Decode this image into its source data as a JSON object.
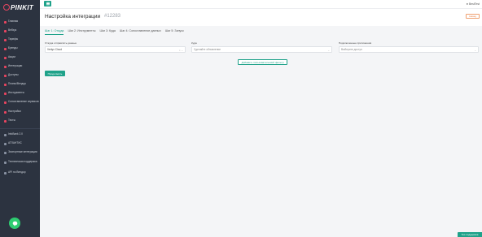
{
  "app": {
    "logo": "PINKIT"
  },
  "topbar": {
    "user_name": "BestTest"
  },
  "header": {
    "title": "Настройка интеграции",
    "id": "#12283",
    "back_label": "Назад"
  },
  "sidebar": {
    "items": [
      {
        "label": "Главная",
        "icon": "home-icon"
      },
      {
        "label": "Вебхук",
        "icon": "webhook-icon"
      },
      {
        "label": "Тарифы",
        "icon": "tariff-icon"
      },
      {
        "label": "Бренды",
        "icon": "brand-icon"
      },
      {
        "label": "Акции",
        "icon": "promo-icon"
      },
      {
        "label": "Интеграции",
        "icon": "integration-icon"
      },
      {
        "label": "Доступы",
        "icon": "access-icon"
      },
      {
        "label": "Планы/Вендор",
        "icon": "plan-icon"
      },
      {
        "label": "Инструменты",
        "icon": "tools-icon"
      },
      {
        "label": "Сопоставление сервисов",
        "icon": "mapping-icon"
      },
      {
        "label": "Настройки",
        "icon": "settings-icon"
      },
      {
        "label": "Тесты",
        "icon": "tests-icon"
      }
    ],
    "secondary": [
      {
        "label": "InfoBank 2.0",
        "icon": "bank-icon"
      },
      {
        "label": "АТЛАНТИС",
        "icon": "atlantis-icon"
      },
      {
        "label": "Экспортные интеграции",
        "icon": "export-icon"
      },
      {
        "label": "Техническая поддержка",
        "icon": "support-icon"
      },
      {
        "label": "API по Вендор",
        "icon": "api-icon"
      }
    ]
  },
  "tabs": [
    {
      "label": "Шаг 1: Откуда",
      "active": true
    },
    {
      "label": "Шаг 2: Инструменты",
      "active": false
    },
    {
      "label": "Шаг 3: Куда",
      "active": false
    },
    {
      "label": "Шаг 4: Сопоставление данных",
      "active": false
    },
    {
      "label": "Шаг 5: Запуск",
      "active": false
    }
  ],
  "form": {
    "source": {
      "label": "Откуда отправлять данные",
      "value": "Vertyx Cloud"
    },
    "target": {
      "label": "Куда",
      "placeholder": "Сделайте обновление"
    },
    "connected": {
      "label": "Подключенные приложения",
      "placeholder": "Выберите доступ"
    },
    "add_field_label": "Добавить пользовательский фильтр",
    "next_label": "Продолжить"
  },
  "support": {
    "label": "Тех.поддержка"
  },
  "colors": {
    "accent": "#1fa28a",
    "brand": "#e94560",
    "sidebar": "#2c3340"
  }
}
